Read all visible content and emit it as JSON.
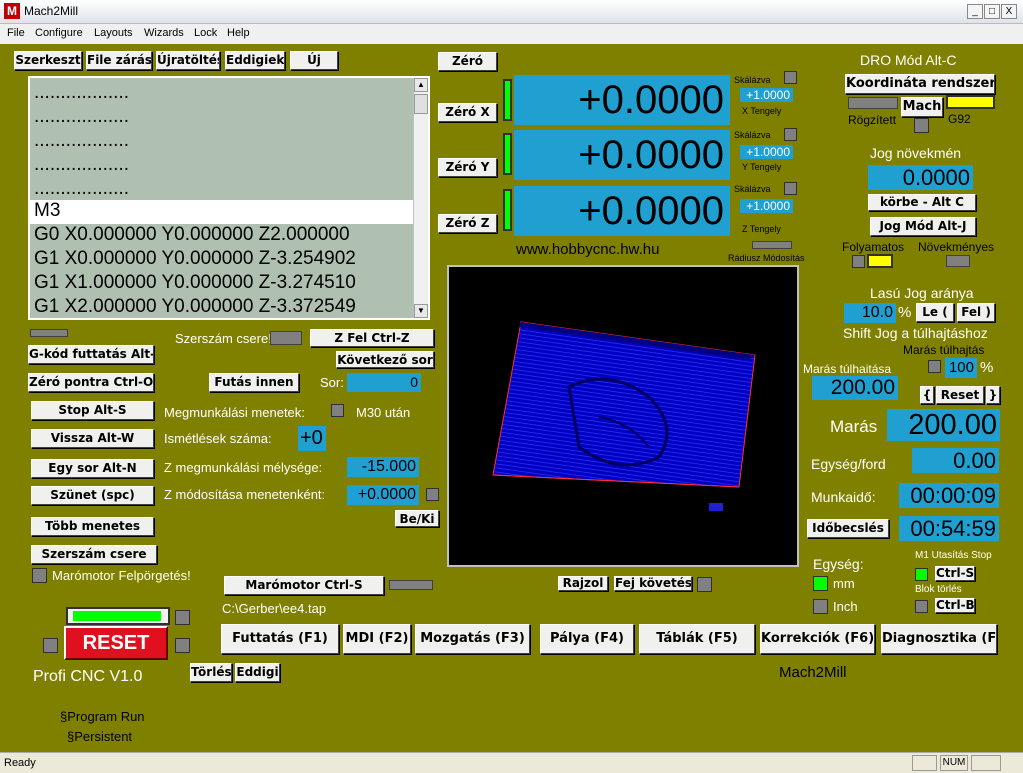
{
  "window": {
    "title": "Mach2Mill",
    "app_letter": "M",
    "min": "_",
    "max": "□",
    "close": "X"
  },
  "menu": [
    "File",
    "Configure",
    "Layouts",
    "Wizards",
    "Lock",
    "Help"
  ],
  "topbuttons": [
    "Szerkeszt",
    "File zárás",
    "Újratöltés",
    "Eddigiek",
    "Új"
  ],
  "gcode": {
    "lines": [
      "..................",
      "..................",
      "..................",
      "..................",
      "..................",
      "M3",
      "G0 X0.000000 Y0.000000 Z2.000000",
      "G1 X0.000000 Y0.000000 Z-3.254902",
      "G1 X1.000000 Y0.000000 Z-3.274510",
      "G1 X2.000000 Y0.000000 Z-3.372549"
    ]
  },
  "left": {
    "gkod": "G-kód futtatás Alt-R",
    "szerszam_csere_q": "Szerszám csere!",
    "zfel": "Z Fel Ctrl-Z",
    "kovetkezo": "Következő sor",
    "zero_pontra": "Zéró pontra Ctrl-O",
    "futas_innen": "Futás innen",
    "sor_label": "Sor:",
    "sor_value": "0",
    "stop": "Stop Alt-S",
    "megmunk": "Megmunkálási menetek:",
    "m30": "M30 után",
    "vissza": "Vissza Alt-W",
    "ismetlesek": "Ismétlések száma:",
    "ismetlesek_value": "+0",
    "egysor": "Egy sor Alt-N",
    "zmelyseg": "Z megmunkálási mélysége:",
    "zmelyseg_value": "-15.000",
    "szunet": "Szünet (spc)",
    "zmodositasa": "Z módosítása menetenként:",
    "zmod_value": "+0.0000",
    "beki": "Be/Ki",
    "tobb": "Több menetes",
    "szerszam_csere": "Szerszám csere",
    "maromotor_felp": "Marómotor Felpörgetés!",
    "maromotor": "Marómotor Ctrl-S",
    "path": "C:\\Gerber\\ee4.tap",
    "reset": "RESET",
    "profi": "Profi CNC V1.0",
    "torles": "Törlés",
    "eddigi": "Eddigi",
    "prog_run": "§Program Run",
    "persistent": "§Persistent"
  },
  "dro": {
    "zero": "Zéró",
    "axes": [
      {
        "btn": "Zéró X",
        "value": "+0.0000",
        "scale_label": "Skálázva",
        "scale": "+1.0000",
        "axis_label": "X Tengely"
      },
      {
        "btn": "Zéró Y",
        "value": "+0.0000",
        "scale_label": "Skálázva",
        "scale": "+1.0000",
        "axis_label": "Y Tengely"
      },
      {
        "btn": "Zéró Z",
        "value": "+0.0000",
        "scale_label": "Skálázva",
        "scale": "+1.0000",
        "axis_label": "Z Tengely"
      }
    ],
    "url": "www.hobbycnc.hw.hu",
    "radius": "Rádiusz Módosítás",
    "rajzol": "Rajzol",
    "fej": "Fej követés"
  },
  "right": {
    "dro_mod": "DRO Mód Alt-C",
    "koord": "Koordináta rendszer",
    "mach": "Mach",
    "rogzitett": "Rögzített",
    "g92": "G92",
    "jog_novekmeny": "Jog növekmén",
    "jog_value": "0.0000",
    "korbe": "körbe - Alt C",
    "jog_mod": "Jog Mód Alt-J",
    "folyamatos": "Folyamatos",
    "novekmenyes": "Növekményes",
    "lasu_jog": "Lasú Jog aránya",
    "lasu_value": "10.0",
    "pct": "%",
    "le": "Le (",
    "fel": "Fel )",
    "shift": "Shift Jog a túlhajtáshoz",
    "maras_tulh": "Marás túlhajtás",
    "maras_tulh_value": "100",
    "maras_tulhaitasa": "Marás túlhaitása",
    "maras_tulh2_value": "200.00",
    "open_brace": "{",
    "reset": "Reset",
    "close_brace": "}",
    "maras": "Marás",
    "maras_value": "200.00",
    "egyseg_ford": "Egység/ford",
    "egyseg_ford_value": "0.00",
    "munkaido": "Munkaidő:",
    "munkaido_value": "00:00:09",
    "idobecsles": "Időbecslés",
    "idobecsles_value": "00:54:59",
    "egyseg": "Egység:",
    "mm": "mm",
    "inch": "Inch",
    "m1": "M1 Utasítás Stop",
    "ctrls": "Ctrl-S",
    "blok": "Blok törlés",
    "ctrlb": "Ctrl-B",
    "mach2mill": "Mach2Mill"
  },
  "tabs": [
    "Futtatás (F1)",
    "MDI (F2)",
    "Mozgatás (F3)",
    "Pálya (F4)",
    "Táblák (F5)",
    "Korrekciók (F6)",
    "Diagnosztika (F7)"
  ],
  "status": {
    "ready": "Ready",
    "num": "NUM"
  },
  "colors": {
    "background": "#808000",
    "dro": "#1fa0d0",
    "led_on": "#00ff00"
  }
}
